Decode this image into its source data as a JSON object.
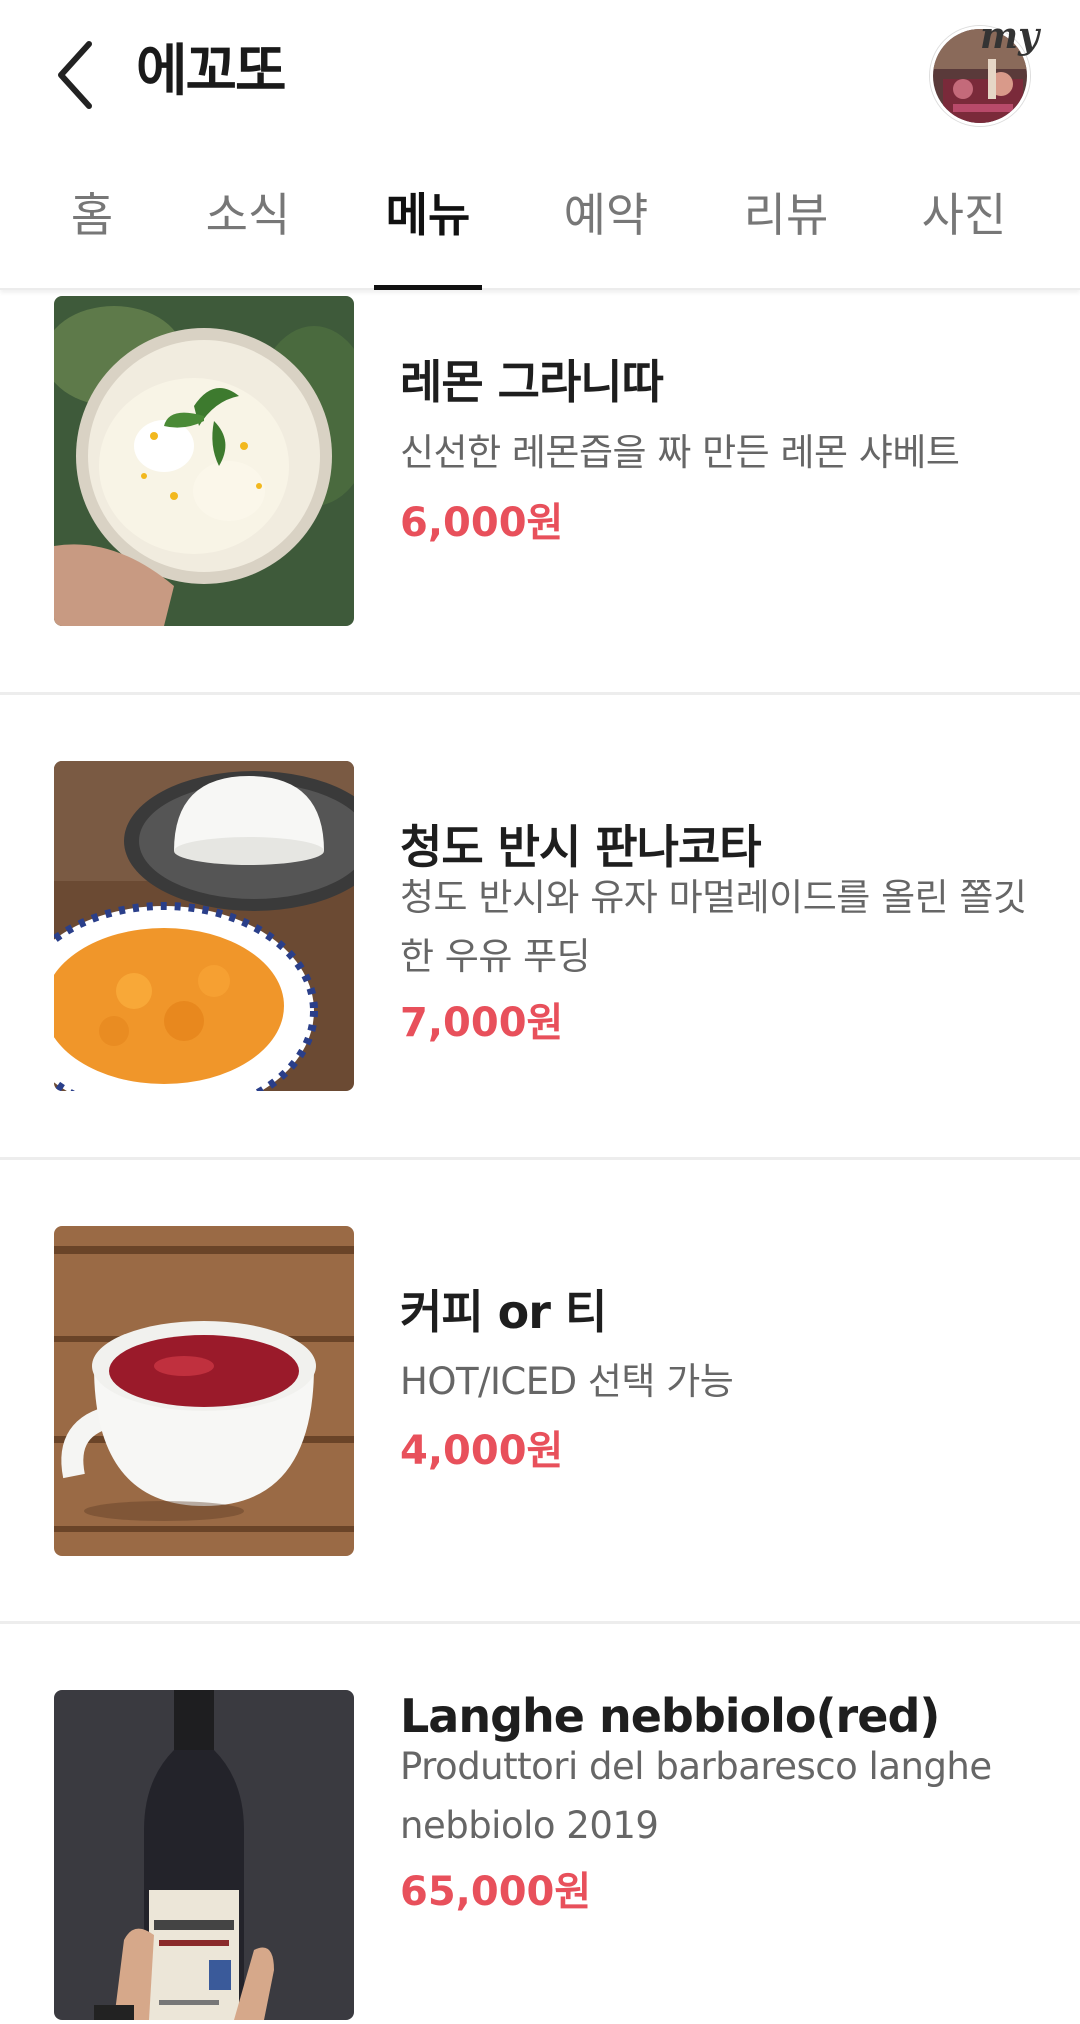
{
  "header": {
    "title": "에꼬또",
    "avatar_badge": "my"
  },
  "tabs": [
    {
      "label": "홈",
      "active": false
    },
    {
      "label": "소식",
      "active": false
    },
    {
      "label": "메뉴",
      "active": true
    },
    {
      "label": "예약",
      "active": false
    },
    {
      "label": "리뷰",
      "active": false
    },
    {
      "label": "사진",
      "active": false
    }
  ],
  "menu": [
    {
      "name": "레몬 그라니따",
      "description": "신선한 레몬즙을 짜 만든 레몬 샤베트",
      "price": "6,000원",
      "image": "lemon-granita-photo"
    },
    {
      "name": "청도 반시 판나코타",
      "description": "청도 반시와 유자 마멀레이드를 올린 쫄깃한 우유 푸딩",
      "price": "7,000원",
      "image": "panna-cotta-photo"
    },
    {
      "name": "커피 or 티",
      "description": "HOT/ICED 선택 가능",
      "price": "4,000원",
      "image": "tea-cup-photo"
    },
    {
      "name": "Langhe nebbiolo(red)",
      "description": "Produttori del barbaresco langhe nebbiolo 2019",
      "price": "65,000원",
      "image": "wine-bottle-photo"
    }
  ],
  "colors": {
    "price": "#e8505b",
    "active_tab": "#111111",
    "inactive_tab": "#777777"
  }
}
